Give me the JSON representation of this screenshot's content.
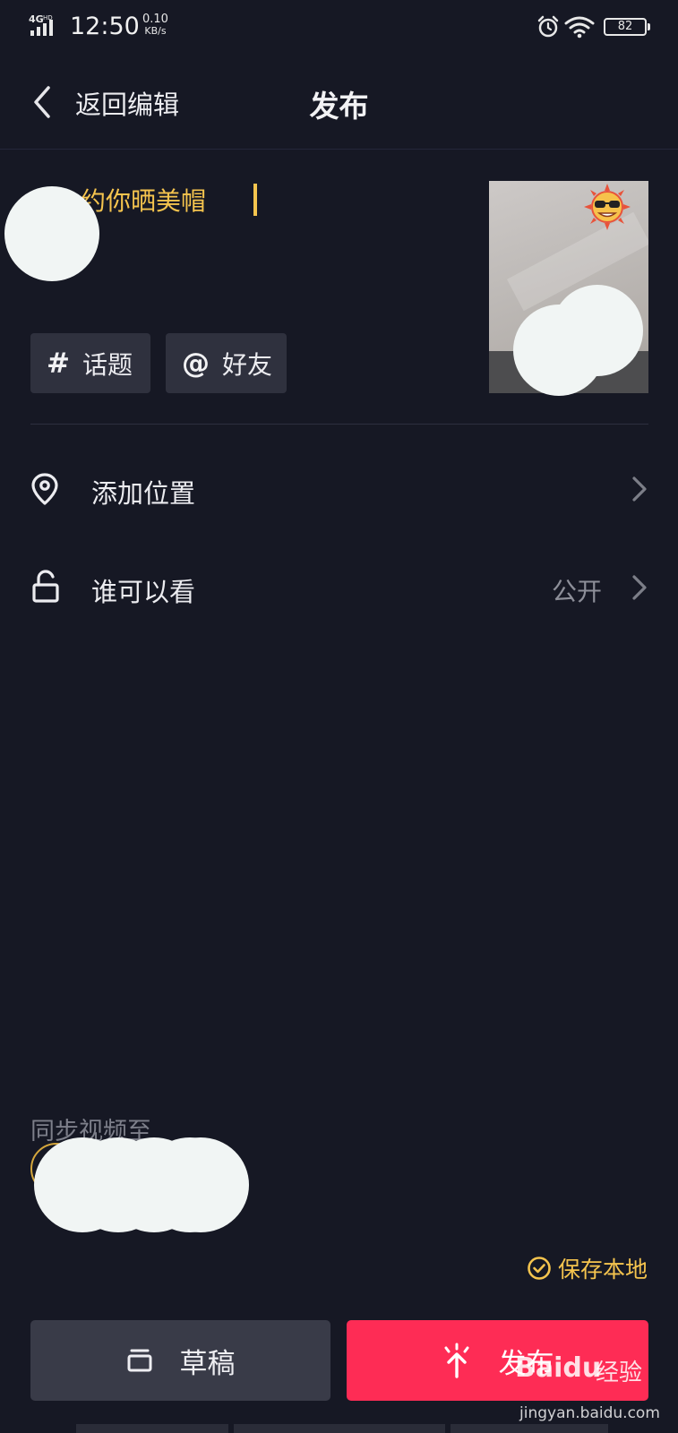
{
  "status_bar": {
    "network": "4GHD",
    "time": "12:50",
    "speed_value": "0.10",
    "speed_unit": "KB/s",
    "battery": "82",
    "icons": [
      "signal-icon",
      "alarm-icon",
      "wifi-icon",
      "battery-icon"
    ]
  },
  "header": {
    "back_label": "返回编辑",
    "title": "发布"
  },
  "post": {
    "caption": "约你晒美帽",
    "cover_sticker": "sunglasses-sun-emoji"
  },
  "chips": [
    {
      "icon": "#",
      "label": "话题"
    },
    {
      "icon": "@",
      "label": "好友"
    }
  ],
  "rows": {
    "location": {
      "label": "添加位置",
      "icon": "location-pin-icon"
    },
    "visibility": {
      "label": "谁可以看",
      "value": "公开",
      "icon": "unlock-icon"
    }
  },
  "sync": {
    "label": "同步视频至"
  },
  "save_local": {
    "label": "保存本地",
    "checked": true
  },
  "buttons": {
    "draft": "草稿",
    "publish": "发布"
  },
  "watermark": {
    "logo": "Baidu",
    "brand_cn": "经验",
    "url": "jingyan.baidu.com"
  },
  "colors": {
    "background": "#161824",
    "accent_yellow": "#f5c44e",
    "publish_red": "#fe2c55",
    "chip_bg": "#2f313e"
  }
}
